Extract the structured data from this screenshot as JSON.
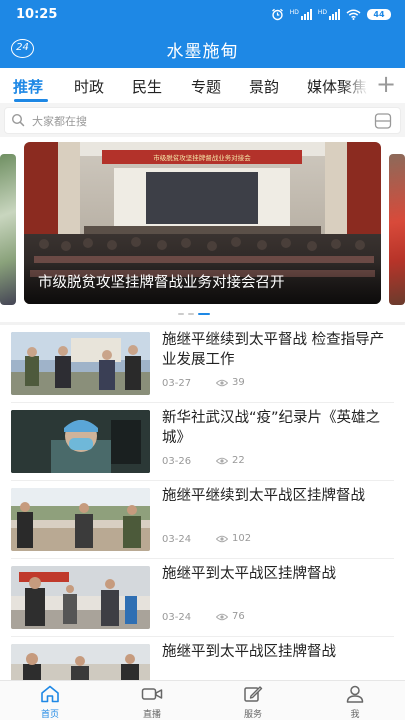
{
  "status_bar": {
    "time": "10:25",
    "signal_label": "HD",
    "battery": "44",
    "icons": [
      "alarm-icon",
      "signal-icon",
      "signal-icon",
      "wifi-icon",
      "battery-icon"
    ]
  },
  "app_bar": {
    "title": "水墨施甸",
    "logo_text": "24"
  },
  "tabs": [
    {
      "label": "推荐",
      "active": true
    },
    {
      "label": "时政",
      "active": false
    },
    {
      "label": "民生",
      "active": false
    },
    {
      "label": "专题",
      "active": false
    },
    {
      "label": "景韵",
      "active": false
    },
    {
      "label": "媒体聚焦",
      "active": false
    }
  ],
  "add_tab_icon": "plus-icon",
  "search": {
    "placeholder": "大家都在搜"
  },
  "banner": {
    "caption": "市级脱贫攻坚挂牌督战业务对接会召开",
    "backdrop_text": "市级脱贫攻坚挂牌督战业务对接会",
    "page_count": 3,
    "active_page": 3
  },
  "news": [
    {
      "title": "施继平继续到太平督战 检查指导产业发展工作",
      "date": "03-27",
      "views": "39"
    },
    {
      "title": "新华社武汉战“疫”纪录片《英雄之城》",
      "date": "03-26",
      "views": "22"
    },
    {
      "title": "施继平继续到太平战区挂牌督战",
      "date": "03-24",
      "views": "102"
    },
    {
      "title": "施继平到太平战区挂牌督战",
      "date": "03-24",
      "views": "76"
    },
    {
      "title": "施继平到太平战区挂牌督战",
      "date": "",
      "views": ""
    }
  ],
  "bottom_nav": [
    {
      "label": "首页",
      "icon": "home-icon",
      "active": true
    },
    {
      "label": "直播",
      "icon": "video-icon",
      "active": false
    },
    {
      "label": "服务",
      "icon": "edit-icon",
      "active": false
    },
    {
      "label": "我",
      "icon": "user-icon",
      "active": false
    }
  ],
  "colors": {
    "primary": "#1e88e5",
    "text": "#222222",
    "muted": "#999999"
  }
}
